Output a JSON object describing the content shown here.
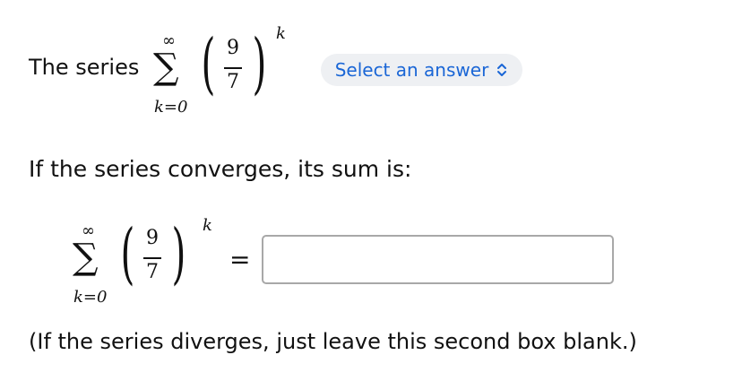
{
  "problem": {
    "lead_text": "The series",
    "series": {
      "sum_symbol": "∑",
      "upper_limit": "∞",
      "lower_limit": "k=0",
      "numerator": "9",
      "denominator": "7",
      "exponent": "k"
    },
    "convergence_select": {
      "selected_label": "Select an answer",
      "accent_color": "#1a66d6",
      "icon": "chevron-up-down-icon"
    },
    "question": "If the series converges, its sum is:",
    "equals_sign": "=",
    "sum_input": {
      "value": "",
      "placeholder": ""
    },
    "note": "(If the series diverges, just leave this second box blank.)"
  }
}
